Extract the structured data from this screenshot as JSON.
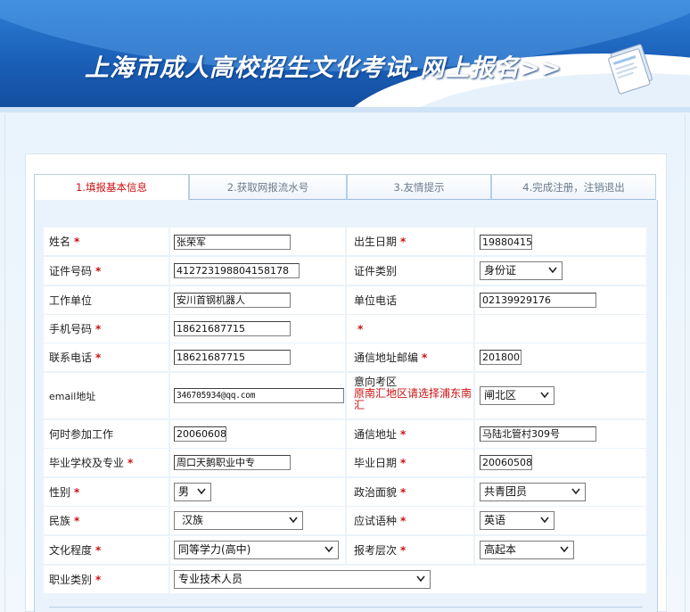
{
  "header": {
    "title": "上海市成人高校招生文化考试-网上报名>>"
  },
  "steps": [
    {
      "label": "1.填报基本信息",
      "active": true
    },
    {
      "label": "2.获取网报流水号",
      "active": false
    },
    {
      "label": "3.友情提示",
      "active": false
    },
    {
      "label": "4.完成注册，注销退出",
      "active": false
    }
  ],
  "form": {
    "required_mark": "*",
    "name": {
      "label": "姓名",
      "value": "张荣军"
    },
    "birth_date": {
      "label": "出生日期",
      "value": "19880415"
    },
    "id_number": {
      "label": "证件号码",
      "value": "412723198804158178"
    },
    "id_type": {
      "label": "证件类别",
      "value": "身份证"
    },
    "employer": {
      "label": "工作单位",
      "value": "安川首钢机器人"
    },
    "employer_phone": {
      "label": "单位电话",
      "value": "02139929176"
    },
    "mobile": {
      "label": "手机号码",
      "value": "18621687715"
    },
    "contact_phone": {
      "label": "联系电话",
      "value": "18621687715"
    },
    "postcode": {
      "label": "通信地址邮编",
      "value": "201800"
    },
    "email": {
      "label": "email地址",
      "value": "346705934@qq.com"
    },
    "exam_district": {
      "label": "意向考区",
      "hint": "原南汇地区请选择浦东南汇",
      "value": "闸北区"
    },
    "work_start": {
      "label": "何时参加工作",
      "value": "20060608"
    },
    "address": {
      "label": "通信地址",
      "value": "马陆北管村309号"
    },
    "school_major": {
      "label": "毕业学校及专业",
      "value": "周口天鹅职业中专"
    },
    "grad_date": {
      "label": "毕业日期",
      "value": "20060508"
    },
    "gender": {
      "label": "性别",
      "value": "男"
    },
    "political": {
      "label": "政治面貌",
      "value": "共青团员"
    },
    "ethnicity": {
      "label": "民族",
      "value": "汉族"
    },
    "exam_language": {
      "label": "应试语种",
      "value": "英语"
    },
    "education": {
      "label": "文化程度",
      "value": "同等学力(高中)"
    },
    "apply_level": {
      "label": "报考层次",
      "value": "高起本"
    },
    "occupation": {
      "label": "职业类别",
      "value": "专业技术人员"
    }
  },
  "colors": {
    "banner": "#1a5fb8",
    "required": "#cc1111",
    "row_bg": "#ffffff",
    "panel_bg": "#eaf3fb"
  }
}
